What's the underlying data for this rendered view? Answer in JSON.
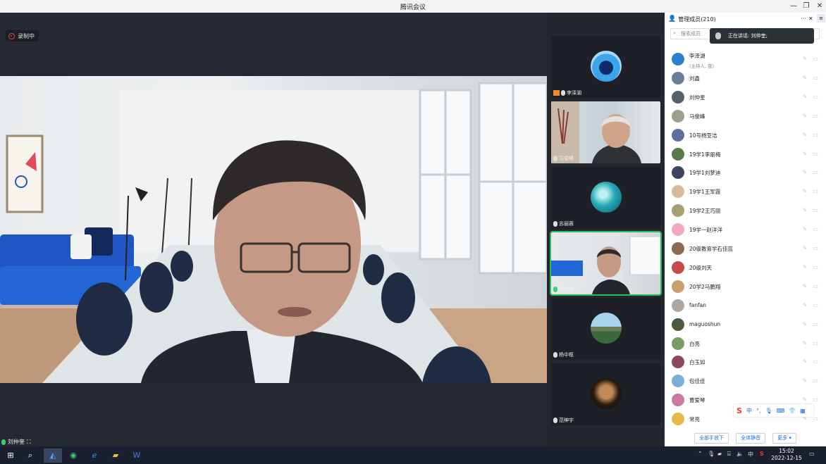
{
  "window": {
    "title": "腾讯会议",
    "minimize": "—",
    "restore": "❐",
    "close": "✕"
  },
  "stage": {
    "recording_label": "录制中",
    "active_speaker_name": "刘仲奎"
  },
  "tiles": [
    {
      "name": "李泽湖",
      "avatar_color": "#2a8fd8",
      "host": true
    },
    {
      "name": "马俊峰",
      "avatar_color": "#a5978b"
    },
    {
      "name": "苏丽蓉",
      "avatar_color": "#26a8b5"
    },
    {
      "name": "刘仲奎",
      "avatar_color": "#6c8aa8",
      "active": true
    },
    {
      "name": "杨中枢",
      "avatar_color": "#5d7a92"
    },
    {
      "name": "范绅宇",
      "avatar_color": "#3a2a1a"
    }
  ],
  "panel": {
    "title": "管理成员(210)",
    "more_label": "···",
    "close_label": "✕",
    "search_placeholder": "搜索成员",
    "toast_text": "正在讲话: 刘仲奎;",
    "members": [
      {
        "name": "李泽湖",
        "sub": "(主持人, 我)",
        "color": "#2a7fcf"
      },
      {
        "name": "刘鑫",
        "sub": "",
        "color": "#6b7d9b"
      },
      {
        "name": "刘仲奎",
        "sub": "",
        "color": "#55606d"
      },
      {
        "name": "马俊峰",
        "sub": "",
        "color": "#9aa28a"
      },
      {
        "name": "10号杨亚洁",
        "sub": "",
        "color": "#5d6f9a"
      },
      {
        "name": "19学1李丽梅",
        "sub": "",
        "color": "#5a7a4a"
      },
      {
        "name": "19学1刘梦迪",
        "sub": "",
        "color": "#3b4560"
      },
      {
        "name": "19学1王军霞",
        "sub": "",
        "color": "#d8b79a"
      },
      {
        "name": "19学2王巧丽",
        "sub": "",
        "color": "#a8a070"
      },
      {
        "name": "19学一赵洋洋",
        "sub": "",
        "color": "#f2a8c0"
      },
      {
        "name": "20级教育学石佳蕊",
        "sub": "",
        "color": "#8a6a50"
      },
      {
        "name": "20级刘天",
        "sub": "",
        "color": "#c84a4a"
      },
      {
        "name": "20学2马鹏翔",
        "sub": "",
        "color": "#c8a070"
      },
      {
        "name": "fanfan",
        "sub": "",
        "color": "#b0a8a0"
      },
      {
        "name": "maguoshun",
        "sub": "",
        "color": "#4a5a3a"
      },
      {
        "name": "白亮",
        "sub": "",
        "color": "#7a9a6a"
      },
      {
        "name": "白玉如",
        "sub": "",
        "color": "#8a4a5a"
      },
      {
        "name": "包佳佳",
        "sub": "",
        "color": "#7ab0d8"
      },
      {
        "name": "曹爱琴",
        "sub": "",
        "color": "#c87aa0"
      },
      {
        "name": "常亮",
        "sub": "",
        "color": "#e8b84a"
      }
    ],
    "buttons": {
      "lower_all_hands": "全部手放下",
      "mute_all": "全体静音",
      "more": "更多 ▾"
    }
  },
  "ime": {
    "logo": "S",
    "mode": "中"
  },
  "taskbar": {
    "time": "15:02",
    "date": "2022-12-15",
    "ime_indicator": "中",
    "apps": [
      "start-icon",
      "search-icon",
      "tencent-meeting-icon",
      "wechat-icon",
      "ie-icon",
      "file-explorer-icon",
      "word-icon"
    ]
  }
}
